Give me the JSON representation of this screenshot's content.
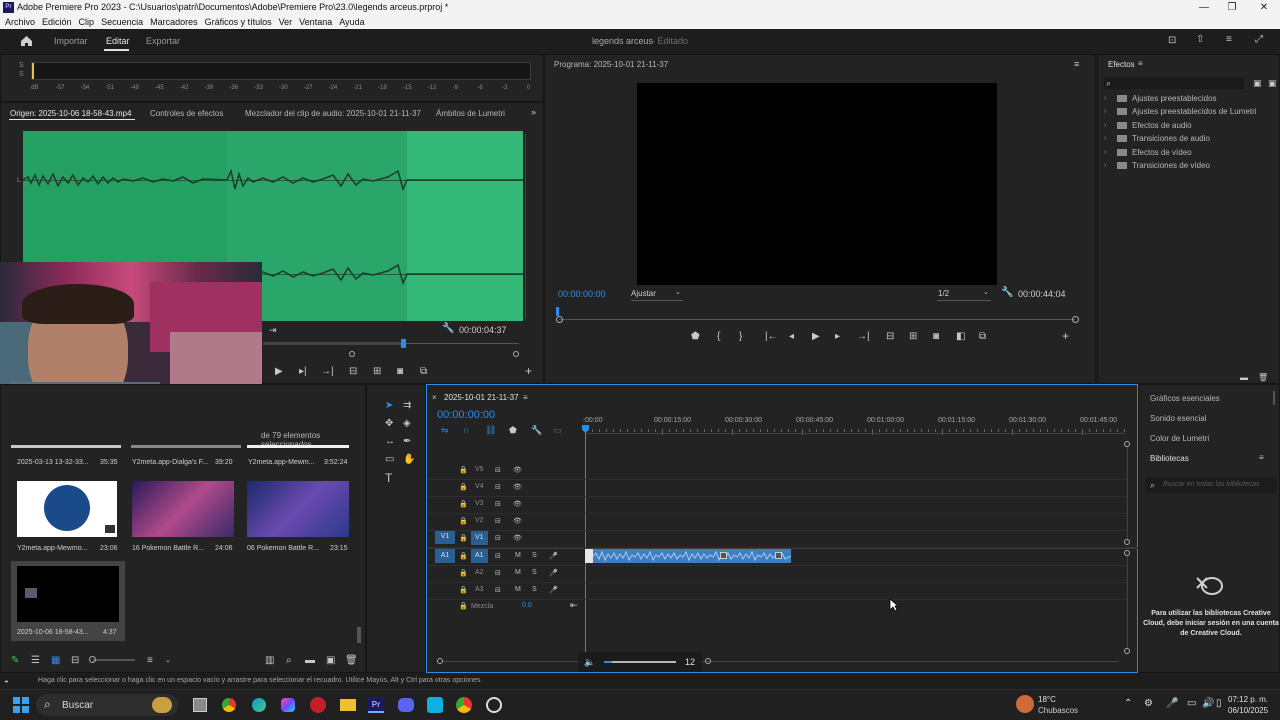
{
  "window": {
    "title": "Adobe Premiere Pro 2023 - C:\\Usuarios\\patri\\Documentos\\Adobe\\Premiere Pro\\23.0\\legends arceus.prproj *",
    "app_icon": "Pr",
    "controls": [
      "—",
      "❐",
      "✕"
    ]
  },
  "menu": [
    "Archivo",
    "Edición",
    "Clip",
    "Secuencia",
    "Marcadores",
    "Gráficos y títulos",
    "Ver",
    "Ventana",
    "Ayuda"
  ],
  "header": {
    "tabs": [
      "Importar",
      "Editar",
      "Exportar"
    ],
    "active_tab": "Editar",
    "project_name": "legends arceus",
    "project_status": "- Editado"
  },
  "audio_meter": {
    "labels": [
      "S",
      "S"
    ],
    "scale": [
      "dB",
      "-57",
      "-54",
      "-51",
      "-48",
      "-45",
      "-42",
      "-39",
      "-36",
      "-33",
      "-30",
      "-27",
      "-24",
      "-21",
      "-18",
      "-15",
      "-12",
      "-9",
      "-6",
      "-3",
      "0"
    ]
  },
  "source_panel": {
    "tabs": [
      "Origen: 2025-10-06 18-58-43.mp4",
      "Controles de efectos",
      "Mezclador del clip de audio: 2025-10-01 21-11-37",
      "Ámbitos de Lumetri"
    ],
    "channel_labels": [
      "L",
      "R"
    ],
    "timecode": "00:00:04:37"
  },
  "program_panel": {
    "title": "Programa: 2025-10-01 21-11-37",
    "current_time": "00:00:00:00",
    "fit_option": "Ajustar",
    "resolution": "1/2",
    "duration": "00:00:44:04"
  },
  "effects_panel": {
    "title": "Efectos",
    "items": [
      "Ajustes preestablecidos",
      "Ajustes preestablecidos de Lumetri",
      "Efectos de audio",
      "Transiciones de audio",
      "Efectos de vídeo",
      "Transiciones de vídeo"
    ]
  },
  "project_panel": {
    "selection_info": "de 79 elementos seleccionados",
    "top_row": [
      {
        "name": "2025-03-13 13-32-33...",
        "duration": "35:35"
      },
      {
        "name": "Y2meta.app-Dialga's F...",
        "duration": "39:20"
      },
      {
        "name": "Y2meta.app-Mewm...",
        "duration": "3:52:24"
      }
    ],
    "items": [
      {
        "name": "Y2meta.app-Mewmo...",
        "duration": "23:06"
      },
      {
        "name": "16 Pokemon Battle R...",
        "duration": "24:06"
      },
      {
        "name": "06 Pokemon Battle R...",
        "duration": "23:15"
      },
      {
        "name": "2025-10-06 18-58-43...",
        "duration": "4:37"
      }
    ]
  },
  "timeline": {
    "sequence_tab": "2025-10-01 21-11-37",
    "timecode": "00:00:00:00",
    "ruler": [
      ":00:00",
      "00:00:15:00",
      "00:00:30:00",
      "00:00:45:00",
      "00:01:00:00",
      "00:01:15:00",
      "00:01:30:00",
      "00:01:45:00"
    ],
    "video_tracks": [
      "V5",
      "V4",
      "V3",
      "V2",
      "V1"
    ],
    "audio_tracks": [
      "A1",
      "A2",
      "A3"
    ],
    "source_patch_video": "V1",
    "source_patch_audio": "A1",
    "mute_label": "M",
    "solo_label": "S",
    "mix_label": "Mezcla",
    "mix_value": "0.0",
    "zoom_value": "12"
  },
  "essential_panels": {
    "items": [
      "Gráficos esenciales",
      "Sonido esencial",
      "Color de Lumetri",
      "Bibliotecas"
    ],
    "search_placeholder": "Buscar en todas las bibliotecas",
    "cc_message": "Para utilizar las bibliotecas Creative Cloud, debe iniciar sesión en una cuenta de Creative Cloud."
  },
  "status_bar": "Haga clic para seleccionar o haga clic en un espacio vacío y arrastre para seleccionar el recuadro. Utilice Mayús, Alt y Ctrl para otras opciones.",
  "taskbar": {
    "search_placeholder": "Buscar",
    "weather_temp": "18°C",
    "weather_desc": "Chubascos",
    "time": "07:12 p. m.",
    "date": "06/10/2025"
  },
  "colors": {
    "accent_blue": "#2d8ceb",
    "waveform_green": "#27a86a",
    "clip_blue": "#3d7fc1"
  }
}
